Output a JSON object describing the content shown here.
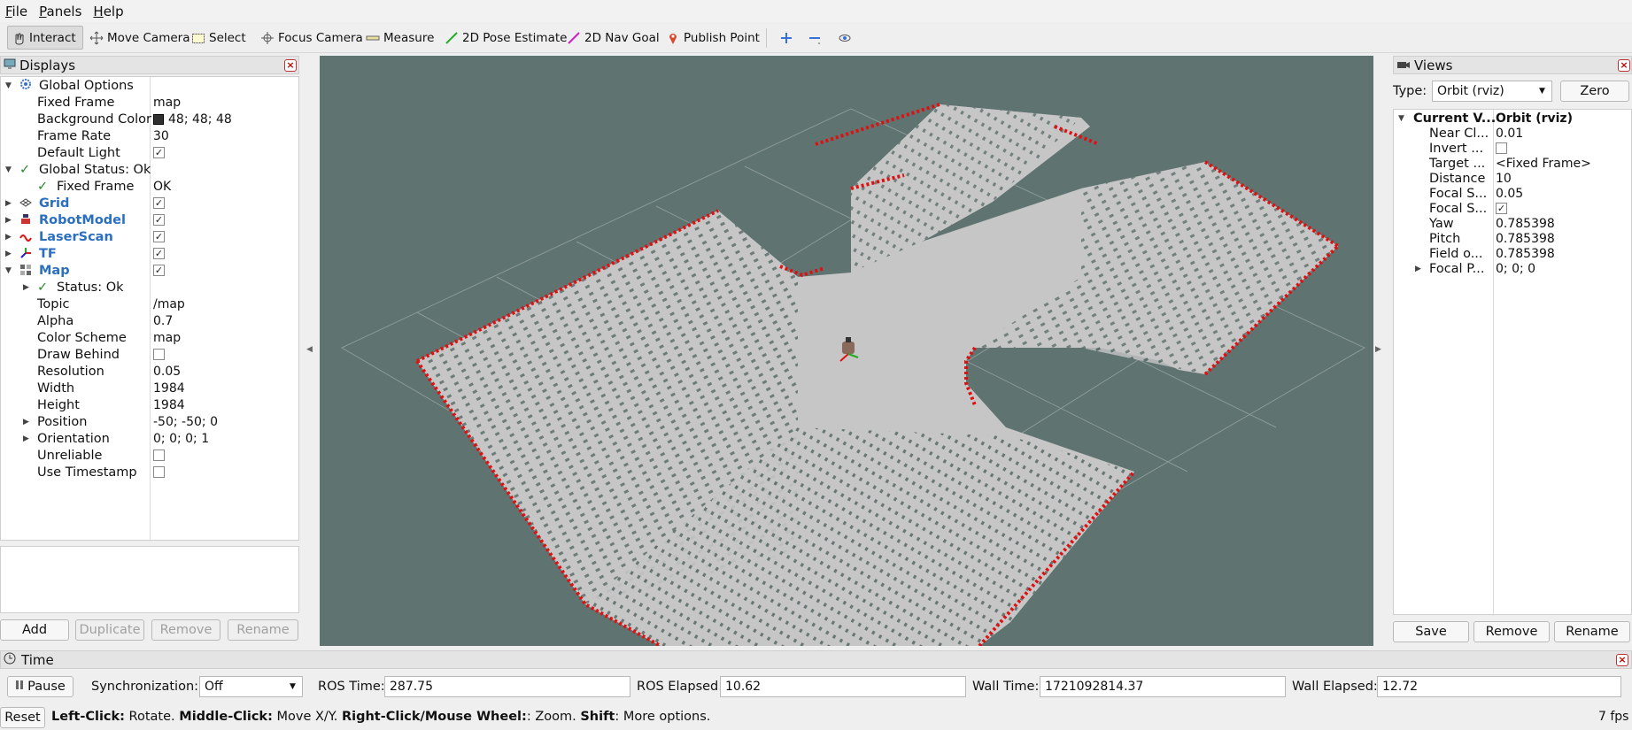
{
  "menubar": {
    "items": [
      "File",
      "Panels",
      "Help"
    ]
  },
  "toolbar": {
    "interact": "Interact",
    "move_camera": "Move Camera",
    "select": "Select",
    "focus_camera": "Focus Camera",
    "measure": "Measure",
    "pose_estimate": "2D Pose Estimate",
    "nav_goal": "2D Nav Goal",
    "publish_point": "Publish Point"
  },
  "displays": {
    "title": "Displays",
    "rows": [
      {
        "label": "Global Options",
        "value": ""
      },
      {
        "label": "Fixed Frame",
        "value": "map"
      },
      {
        "label": "Background Color",
        "value": "48; 48; 48"
      },
      {
        "label": "Frame Rate",
        "value": "30"
      },
      {
        "label": "Default Light",
        "value": ""
      },
      {
        "label": "Global Status: Ok",
        "value": ""
      },
      {
        "label": "Fixed Frame",
        "value": "OK"
      },
      {
        "label": "Grid",
        "value": ""
      },
      {
        "label": "RobotModel",
        "value": ""
      },
      {
        "label": "LaserScan",
        "value": ""
      },
      {
        "label": "TF",
        "value": ""
      },
      {
        "label": "Map",
        "value": ""
      },
      {
        "label": "Status: Ok",
        "value": ""
      },
      {
        "label": "Topic",
        "value": "/map"
      },
      {
        "label": "Alpha",
        "value": "0.7"
      },
      {
        "label": "Color Scheme",
        "value": "map"
      },
      {
        "label": "Draw Behind",
        "value": ""
      },
      {
        "label": "Resolution",
        "value": "0.05"
      },
      {
        "label": "Width",
        "value": "1984"
      },
      {
        "label": "Height",
        "value": "1984"
      },
      {
        "label": "Position",
        "value": "-50; -50; 0"
      },
      {
        "label": "Orientation",
        "value": "0; 0; 0; 1"
      },
      {
        "label": "Unreliable",
        "value": ""
      },
      {
        "label": "Use Timestamp",
        "value": ""
      }
    ],
    "buttons": {
      "add": "Add",
      "duplicate": "Duplicate",
      "remove": "Remove",
      "rename": "Rename"
    }
  },
  "views": {
    "title": "Views",
    "type_label": "Type:",
    "type_value": "Orbit (rviz)",
    "zero": "Zero",
    "rows": [
      {
        "label": "Current V...",
        "value": "Orbit (rviz)"
      },
      {
        "label": "Near Cl...",
        "value": "0.01"
      },
      {
        "label": "Invert ...",
        "value": ""
      },
      {
        "label": "Target ...",
        "value": "<Fixed Frame>"
      },
      {
        "label": "Distance",
        "value": "10"
      },
      {
        "label": "Focal S...",
        "value": "0.05"
      },
      {
        "label": "Focal S...",
        "value": ""
      },
      {
        "label": "Yaw",
        "value": "0.785398"
      },
      {
        "label": "Pitch",
        "value": "0.785398"
      },
      {
        "label": "Field o...",
        "value": "0.785398"
      },
      {
        "label": "Focal P...",
        "value": "0; 0; 0"
      }
    ],
    "buttons": {
      "save": "Save",
      "remove": "Remove",
      "rename": "Rename"
    }
  },
  "time": {
    "title": "Time",
    "pause": "Pause",
    "sync_label": "Synchronization:",
    "sync_value": "Off",
    "ros_time_label": "ROS Time:",
    "ros_time": "287.75",
    "ros_elapsed_label": "ROS Elapsed:",
    "ros_elapsed": "10.62",
    "wall_time_label": "Wall Time:",
    "wall_time": "1721092814.37",
    "wall_elapsed_label": "Wall Elapsed:",
    "wall_elapsed": "12.72"
  },
  "status": {
    "reset": "Reset",
    "b1": "Left-Click:",
    "t1": " Rotate. ",
    "b2": "Middle-Click:",
    "t2": " Move X/Y. ",
    "b3": "Right-Click/Mouse Wheel:",
    "t3": ": Zoom. ",
    "b4": "Shift",
    "t4": ": More options.",
    "fps": "7 fps"
  },
  "colors": {
    "viewport_bg": "#5f7370",
    "laser": "#e01010",
    "map_free": "#c8c8c8"
  }
}
